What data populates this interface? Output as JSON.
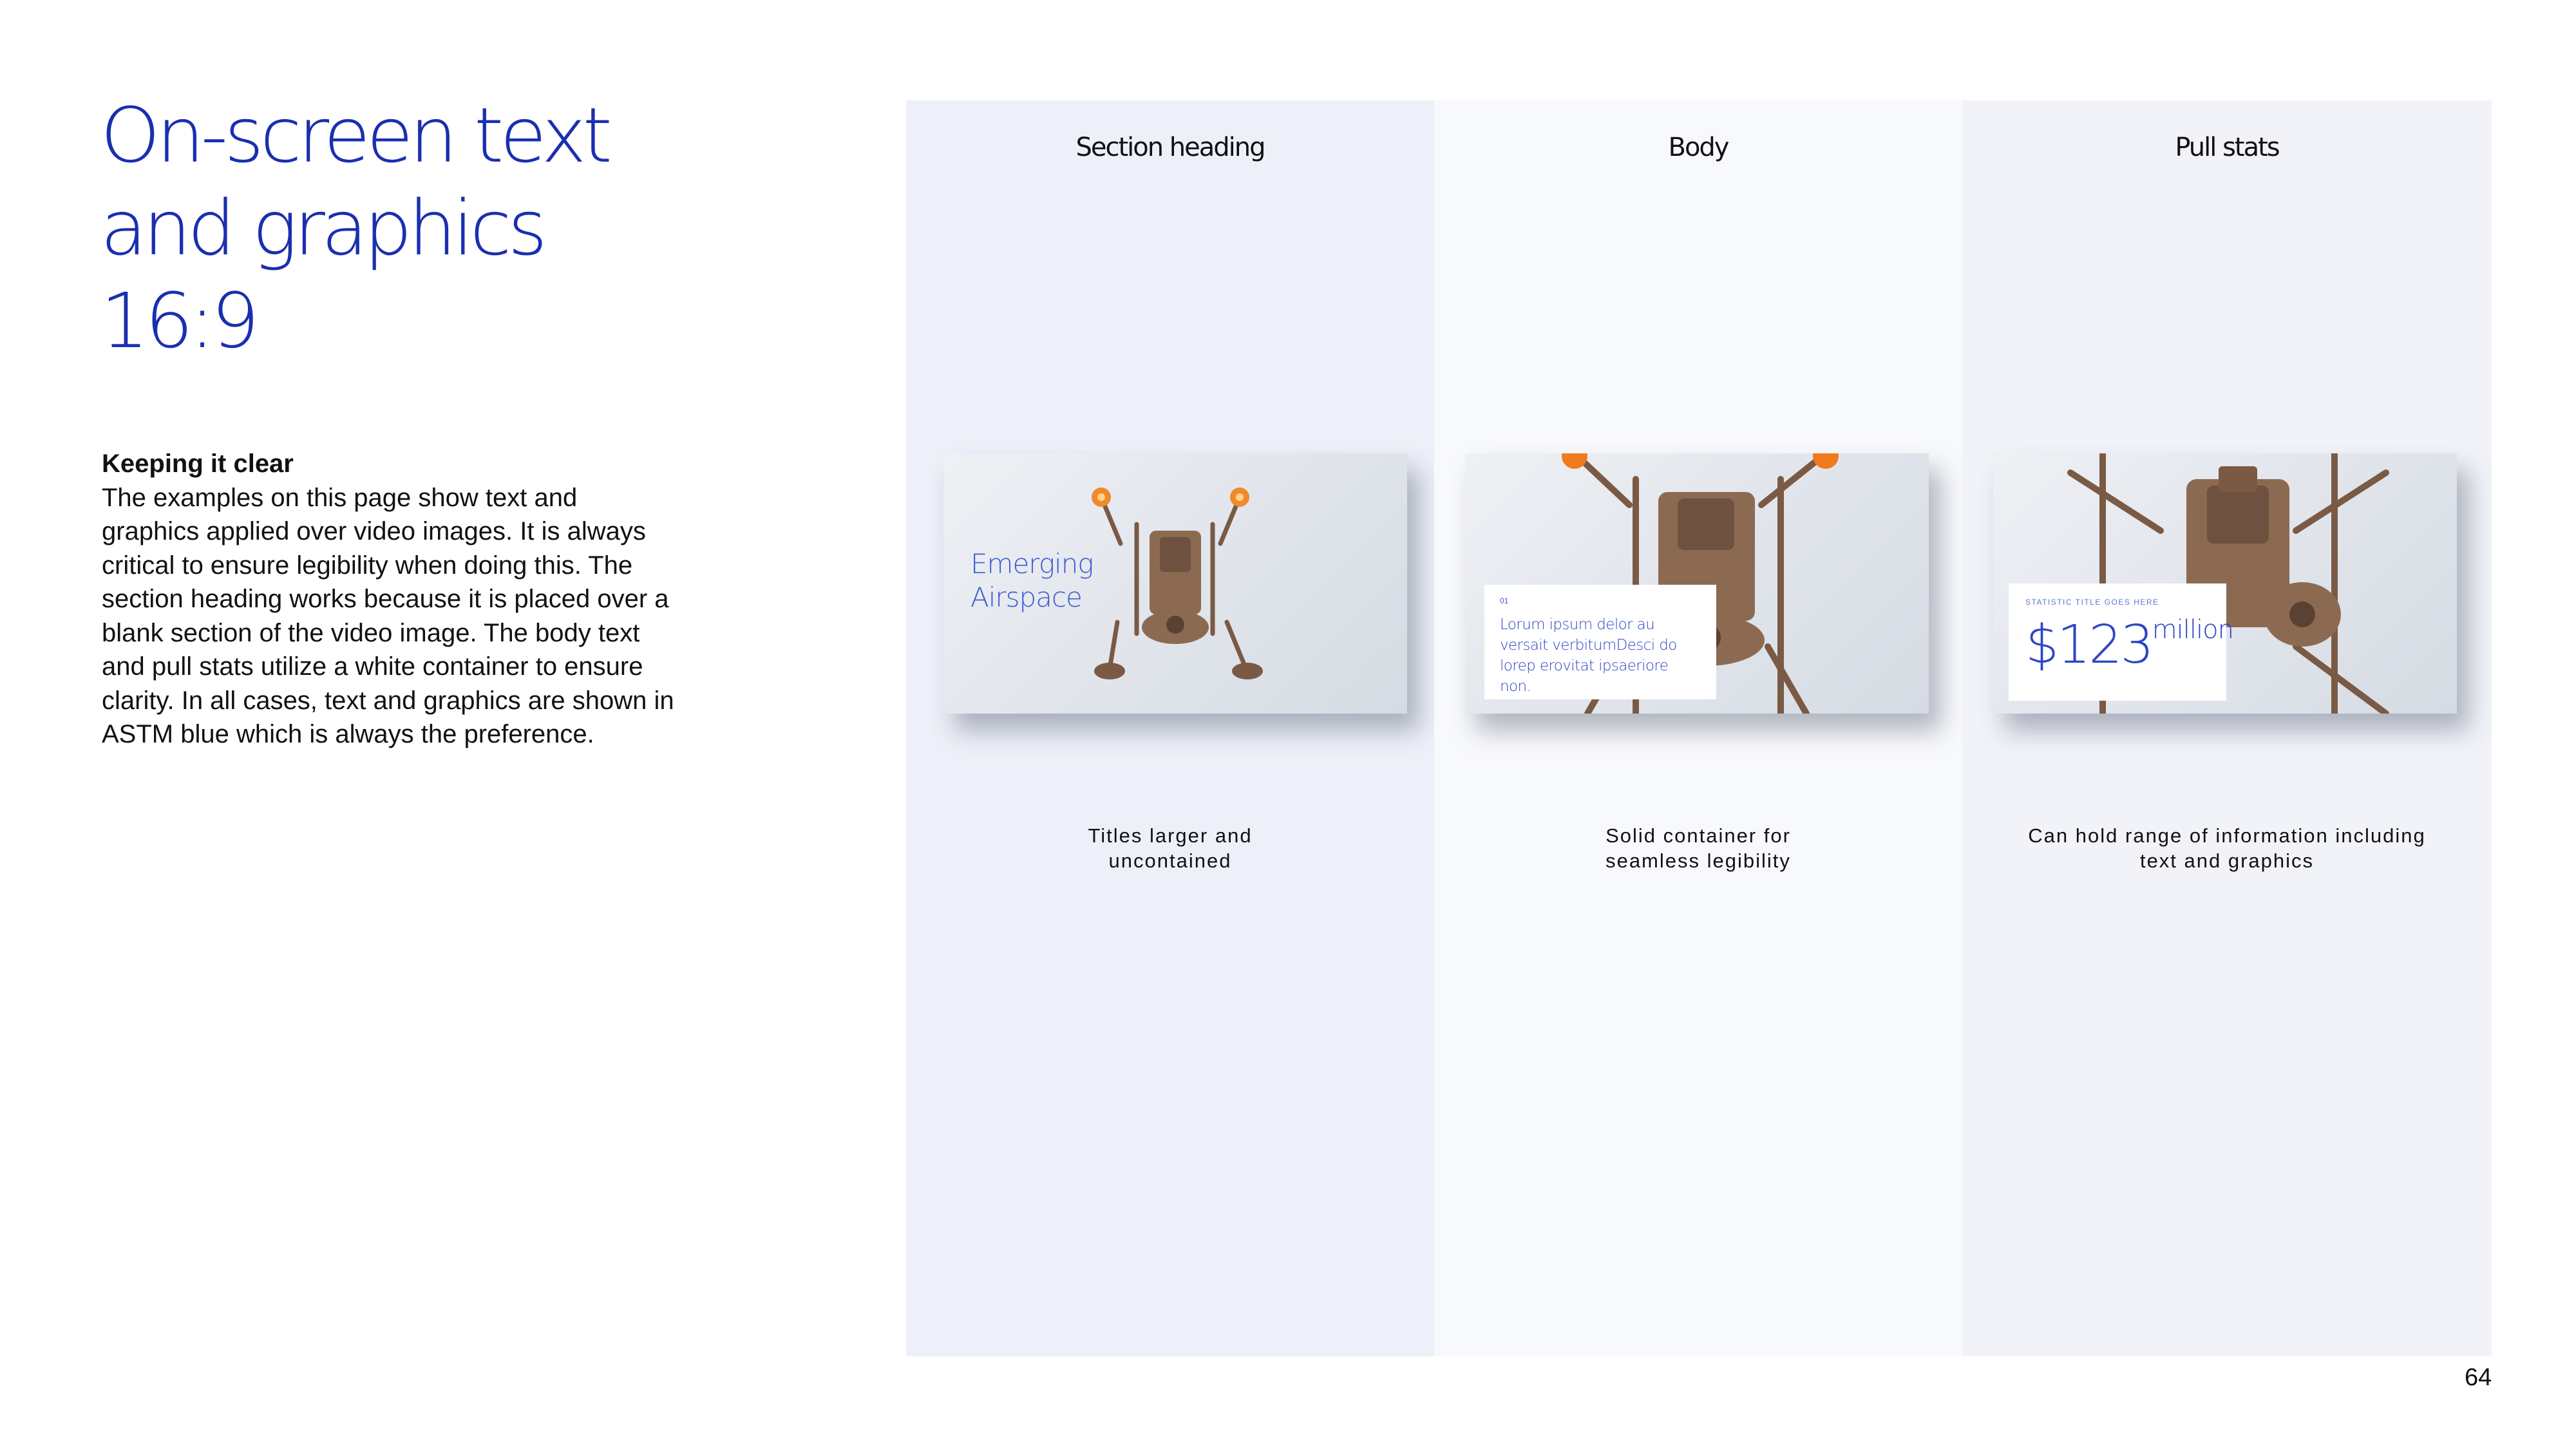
{
  "title": {
    "lines": [
      "On-screen text",
      "and graphics",
      "16:9"
    ]
  },
  "intro": {
    "heading": "Keeping it clear",
    "body": "The examples on this page show text and graphics applied over video images. It is always critical to ensure legibility when doing this. The section heading works because it is placed over a blank section of the video image. The body text and pull stats utilize a white container to ensure clarity. In all cases, text and graphics are shown in ASTM blue which is always the preference."
  },
  "columns": [
    {
      "title": "Section heading",
      "overlay": {
        "lines": [
          "Emerging",
          "Airspace"
        ]
      },
      "caption": [
        "Titles larger and",
        "uncontained"
      ]
    },
    {
      "title": "Body",
      "overlay": {
        "number": "01",
        "text": "Lorum ipsum delor au versait verbitumDesci do lorep erovitat ipsaeriore non."
      },
      "caption": [
        "Solid container for",
        "seamless legibility"
      ]
    },
    {
      "title": "Pull stats",
      "overlay": {
        "label": "STATISTIC TITLE GOES HERE",
        "value": "$123",
        "unit": "million"
      },
      "caption": [
        "Can hold range of information including",
        "text and graphics"
      ]
    }
  ],
  "colors": {
    "brand_blue": "#1a2fb0",
    "overlay_blue": "#2e45c4"
  },
  "page_number": "64"
}
